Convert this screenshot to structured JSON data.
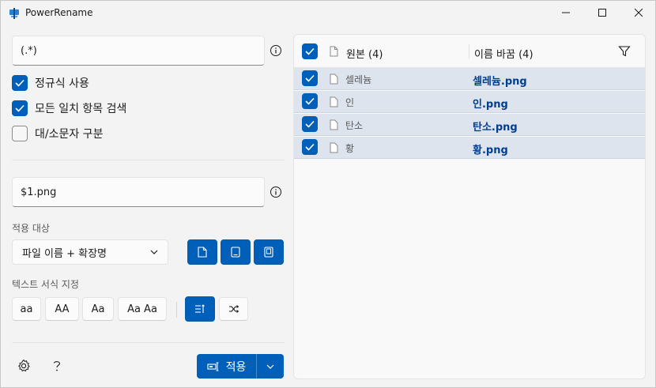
{
  "window": {
    "title": "PowerRename"
  },
  "search": {
    "value": "(.*)"
  },
  "options": {
    "use_regex": {
      "label": "정규식 사용",
      "checked": true
    },
    "match_all": {
      "label": "모든 일치 항목 검색",
      "checked": true
    },
    "case_sensitive": {
      "label": "대/소문자 구분",
      "checked": false
    }
  },
  "replace": {
    "value": "$1.png"
  },
  "apply_to": {
    "label": "적용 대상",
    "selected": "파일 이름 + 확장명"
  },
  "text_format": {
    "label": "텍스트 서식 지정",
    "buttons": [
      "aa",
      "AA",
      "Aa",
      "Aa Aa"
    ]
  },
  "apply_button": {
    "label": "적용"
  },
  "list": {
    "original_header": "원본 (4)",
    "renamed_header": "이름 바꿈 (4)",
    "rows": [
      {
        "original": "셀레늄",
        "renamed": "셀레늄.png"
      },
      {
        "original": "인",
        "renamed": "인.png"
      },
      {
        "original": "탄소",
        "renamed": "탄소.png"
      },
      {
        "original": "황",
        "renamed": "황.png"
      }
    ]
  },
  "colors": {
    "accent": "#005fb8",
    "row_selected": "#dde4ee",
    "renamed_text": "#003e92"
  },
  "icons": [
    "app-icon",
    "minimize-icon",
    "maximize-icon",
    "close-icon",
    "info-icon",
    "file-icon",
    "folder-icon",
    "subfolder-icon",
    "enumerate-icon",
    "shuffle-icon",
    "settings-icon",
    "help-icon",
    "rename-icon",
    "chevron-down-icon",
    "filter-icon",
    "checkmark-icon"
  ]
}
